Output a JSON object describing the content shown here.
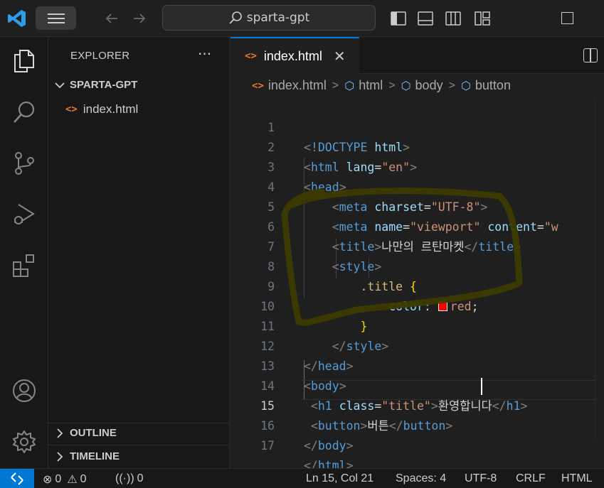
{
  "titlebar": {
    "search_text": "sparta-gpt"
  },
  "sidebar": {
    "title": "EXPLORER",
    "more": "···",
    "folder": "SPARTA-GPT",
    "files": [
      "index.html"
    ],
    "outline": "OUTLINE",
    "timeline": "TIMELINE"
  },
  "editor": {
    "tab_label": "index.html",
    "breadcrumb": [
      "index.html",
      "html",
      "body",
      "button"
    ],
    "active_line": 15,
    "lines": [
      {
        "n": "1"
      },
      {
        "n": "2"
      },
      {
        "n": "3"
      },
      {
        "n": "4"
      },
      {
        "n": "5"
      },
      {
        "n": "6"
      },
      {
        "n": "7"
      },
      {
        "n": "8"
      },
      {
        "n": "9"
      },
      {
        "n": "10"
      },
      {
        "n": "11"
      },
      {
        "n": "12"
      },
      {
        "n": "13"
      },
      {
        "n": "14"
      },
      {
        "n": "15"
      },
      {
        "n": "16"
      },
      {
        "n": "17"
      }
    ],
    "tokens": {
      "doctype": "!DOCTYPE",
      "html": "html",
      "lang": "lang",
      "en": "\"en\"",
      "head": "head",
      "meta": "meta",
      "charset": "charset",
      "utf8": "\"UTF-8\"",
      "name": "name",
      "viewport": "\"viewport\"",
      "content": "content",
      "content_val": "\"w",
      "title_tag": "title",
      "title_text": "나만의 르탄마켓",
      "style_tag": "style",
      "selector": ".title",
      "color_prop": "color",
      "color_val": "red",
      "body": "body",
      "h1": "h1",
      "class_attr": "class",
      "class_val": "\"title\"",
      "h1_text": "환영합니다",
      "button": "button",
      "button_text": "버튼"
    }
  },
  "statusbar": {
    "errors": "0",
    "warnings": "0",
    "broadcast": "0",
    "position": "Ln 15, Col 21",
    "spaces": "Spaces: 4",
    "encoding": "UTF-8",
    "eol": "CRLF",
    "language": "HTML"
  },
  "colors": {
    "accent": "#0078d4",
    "scribble": "#3b3b00",
    "swatch": "#ff0000"
  }
}
